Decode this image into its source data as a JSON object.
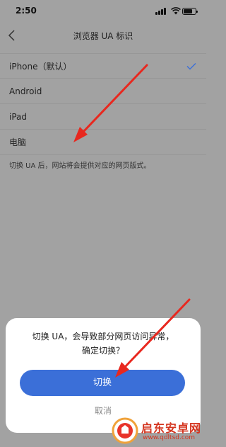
{
  "status_bar": {
    "time": "2:50"
  },
  "nav": {
    "title": "浏览器 UA 标识"
  },
  "ua_options": [
    {
      "label": "iPhone（默认）",
      "selected": true
    },
    {
      "label": "Android",
      "selected": false
    },
    {
      "label": "iPad",
      "selected": false
    },
    {
      "label": "电脑",
      "selected": false
    }
  ],
  "hint": "切换 UA 后，网站将会提供对应的网页版式。",
  "dialog": {
    "message_line1": "切换 UA，会导致部分网页访问异常，",
    "message_line2": "确定切换？",
    "confirm_label": "切换",
    "cancel_label": "取消"
  },
  "watermark": {
    "title": "启东安卓网",
    "url": "www.qdltsd.com"
  },
  "colors": {
    "accent": "#3b6fd8",
    "arrow": "#e8281f",
    "watermark": "#d4341e"
  }
}
